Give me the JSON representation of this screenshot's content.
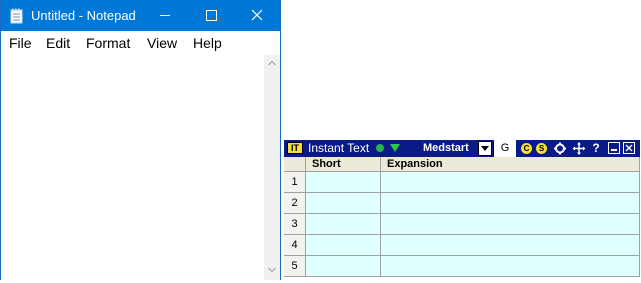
{
  "notepad": {
    "title": "Untitled - Notepad",
    "menu": [
      "File",
      "Edit",
      "Format",
      "View",
      "Help"
    ],
    "content": ""
  },
  "instant_text": {
    "title": "Instant Text",
    "logo": "IT",
    "glossary": "Medstart",
    "g_label": "G",
    "c_label": "C",
    "s_label": "S",
    "help_label": "?",
    "columns": [
      "Short",
      "Expansion"
    ],
    "rows": [
      "1",
      "2",
      "3",
      "4",
      "5"
    ]
  },
  "colors": {
    "notepad_titlebar": "#0078d7",
    "it_titlebar": "#0a1a86",
    "it_cell_bg": "#e0ffff",
    "it_status": "#2ab34a"
  }
}
